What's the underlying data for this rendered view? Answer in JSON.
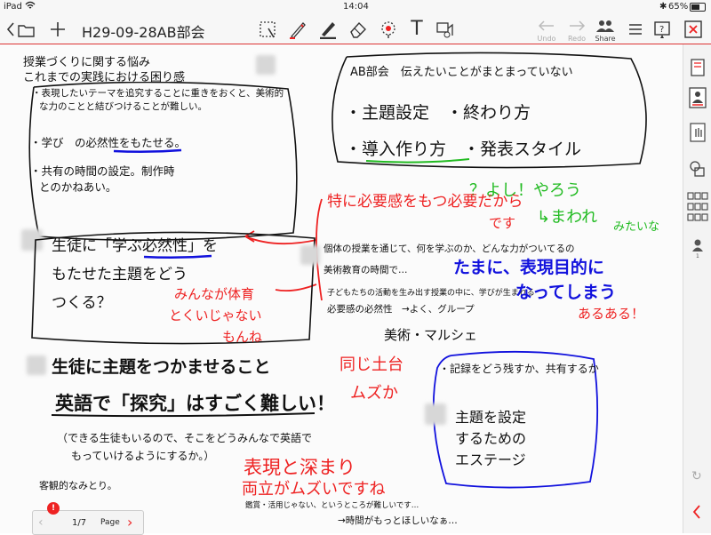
{
  "status": {
    "device": "iPad",
    "time": "14:04",
    "battery": "65%"
  },
  "toolbar": {
    "title": "H29-09-28AB部会",
    "undo": "Undo",
    "redo": "Redo",
    "share": "Share"
  },
  "pager": {
    "page": "1/7",
    "page_label": "Page",
    "badge": "!"
  },
  "notes": {
    "t1": "授業づくりに関する悩み",
    "t2": "これまでの実践における困り感",
    "t3": "・表現したいテーマを追究することに重きをおくと、美術的",
    "t4": "な力のことと結びつけることが難しい。",
    "t5": "・学び　の必然性をもたせる。",
    "t6": "・共有の時間の設定。制作時",
    "t7": "とのかねあい。",
    "ab1": "AB部会　伝えたいことがまとまっていない",
    "ab2": "・主題設定　・終わり方",
    "ab3": "・導入作り方　・発表スタイル",
    "g1": "？よし！やろう",
    "g2": "↳まわれ",
    "g3": "みたいな",
    "r1": "特に必要感をもつ必要だから",
    "r2": "です",
    "m1": "生徒に「学ぶ必然性」を",
    "m2": "もたせた主題をどう",
    "m3": "つくる？",
    "rm1": "みんなが体育",
    "rm2": "とくいじゃない",
    "rm3": "もんね",
    "c1": "個体の授業を通じて、何を学ぶのか、どんな力がついてるの",
    "c2": "美術教育の時間で…",
    "c3": "子どもたちの活動を生み出す授業の中に、学びが生まれる",
    "c4": "必要感の必然性　→よく、グループ",
    "bl1": "たまに、表現目的に",
    "bl2": "なってしまう",
    "ra": "あるある！",
    "mm": "美術・マルシェ",
    "s1": "生徒に主題をつかませること",
    "rs": "同じ土台",
    "rs2": "ムズか",
    "e1": "英語で「探究」はすごく難しい！",
    "e2": "（できる生徒もいるので、そこをどうみんなで英語で",
    "e3": "もっていけるようにするか。）",
    "rh1": "表現と深まり",
    "rh2": "両立がムズいですね",
    "k1": "客観的なみとり。",
    "bb1": "・記録をどう残すか、共有するか",
    "bb2": "主題を設定",
    "bb3": "するための",
    "bb4": "エステージ",
    "f1": "鑑賞・活用じゃない、というところが難しいです…",
    "f2": "→時間がもっとほしいなぁ…"
  },
  "icons": [
    "back-icon",
    "new-note-icon",
    "lasso-icon",
    "pen-red-icon",
    "pen-icon",
    "eraser-icon",
    "highlighter-icon",
    "text-tool-icon",
    "image-tool-icon",
    "undo-icon",
    "redo-icon",
    "share-icon",
    "list-icon",
    "help-icon",
    "close-icon",
    "page-icon",
    "user-icon",
    "hand-icon",
    "layers-icon",
    "grid-icon",
    "person-icon"
  ]
}
